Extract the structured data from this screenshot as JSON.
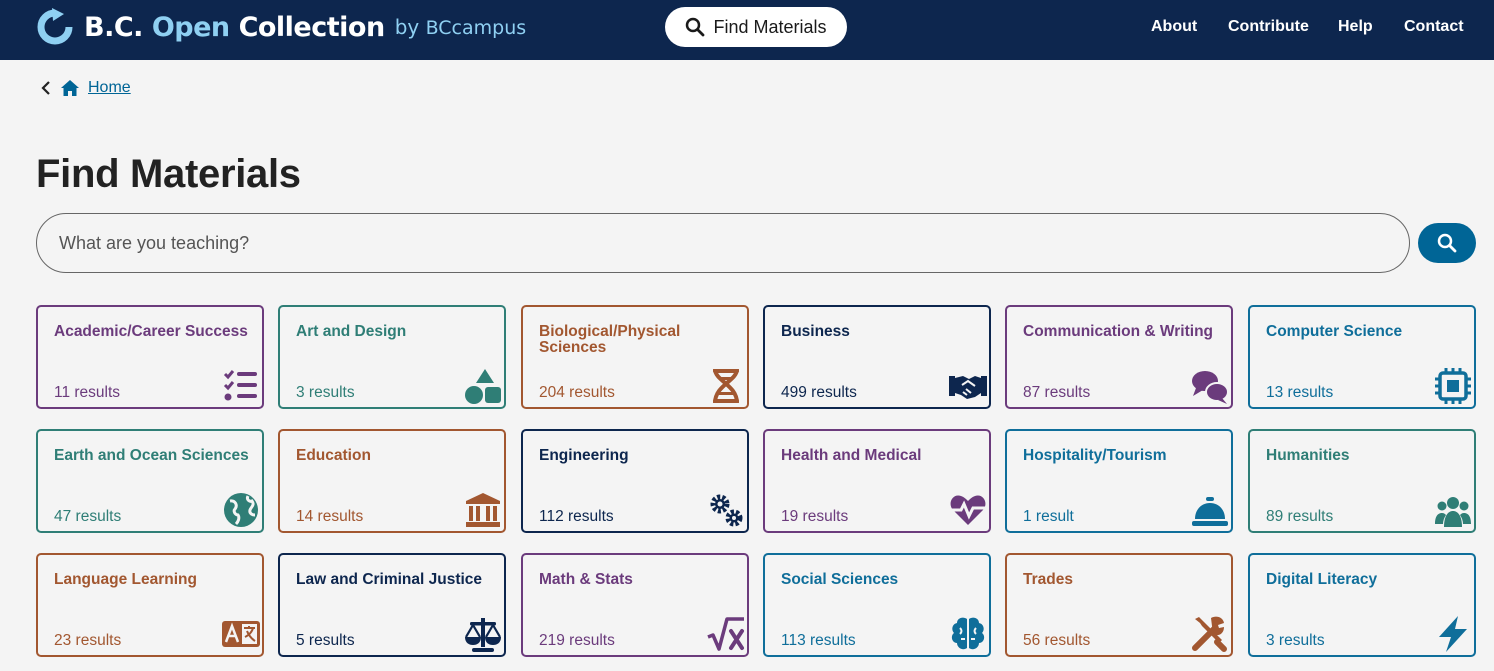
{
  "header": {
    "logo": {
      "brand_a": "B.C.",
      "brand_b": "Open",
      "brand_c": "Collection",
      "by": "by",
      "by_org": "BCcampus"
    },
    "find_button_label": "Find Materials",
    "nav": [
      "About",
      "Contribute",
      "Help",
      "Contact"
    ]
  },
  "breadcrumb": {
    "home_label": "Home"
  },
  "page_title": "Find Materials",
  "search": {
    "placeholder": "What are you teaching?",
    "value": ""
  },
  "colors": {
    "header_bg": "#0d264e",
    "accent": "#006596",
    "purple": "#6b3b7c",
    "teal": "#2f7e76",
    "orange": "#a25730",
    "navy": "#0d264e",
    "blue": "#0f6e9a"
  },
  "subjects": [
    {
      "name": "Academic/Career Success",
      "count": "11 results",
      "icon": "checklist-icon",
      "color": "purple"
    },
    {
      "name": "Art and Design",
      "count": "3 results",
      "icon": "shapes-icon",
      "color": "teal"
    },
    {
      "name": "Biological/Physical Sciences",
      "count": "204 results",
      "icon": "dna-icon",
      "color": "orange"
    },
    {
      "name": "Business",
      "count": "499 results",
      "icon": "handshake-icon",
      "color": "navy"
    },
    {
      "name": "Communication & Writing",
      "count": "87 results",
      "icon": "comments-icon",
      "color": "purple"
    },
    {
      "name": "Computer Science",
      "count": "13 results",
      "icon": "microchip-icon",
      "color": "blue"
    },
    {
      "name": "Earth and Ocean Sciences",
      "count": "47 results",
      "icon": "globe-icon",
      "color": "teal"
    },
    {
      "name": "Education",
      "count": "14 results",
      "icon": "institution-icon",
      "color": "orange"
    },
    {
      "name": "Engineering",
      "count": "112 results",
      "icon": "gears-icon",
      "color": "navy"
    },
    {
      "name": "Health and Medical",
      "count": "19 results",
      "icon": "heart-pulse-icon",
      "color": "purple"
    },
    {
      "name": "Hospitality/Tourism",
      "count": "1 result",
      "icon": "service-bell-icon",
      "color": "blue"
    },
    {
      "name": "Humanities",
      "count": "89 results",
      "icon": "people-group-icon",
      "color": "teal"
    },
    {
      "name": "Language Learning",
      "count": "23 results",
      "icon": "language-icon",
      "color": "orange"
    },
    {
      "name": "Law and Criminal Justice",
      "count": "5 results",
      "icon": "scale-balanced-icon",
      "color": "navy"
    },
    {
      "name": "Math & Stats",
      "count": "219 results",
      "icon": "square-root-icon",
      "color": "purple"
    },
    {
      "name": "Social Sciences",
      "count": "113 results",
      "icon": "brain-icon",
      "color": "blue"
    },
    {
      "name": "Trades",
      "count": "56 results",
      "icon": "screwdriver-wrench-icon",
      "color": "orange"
    },
    {
      "name": "Digital Literacy",
      "count": "3 results",
      "icon": "bolt-icon",
      "color": "blue"
    }
  ]
}
